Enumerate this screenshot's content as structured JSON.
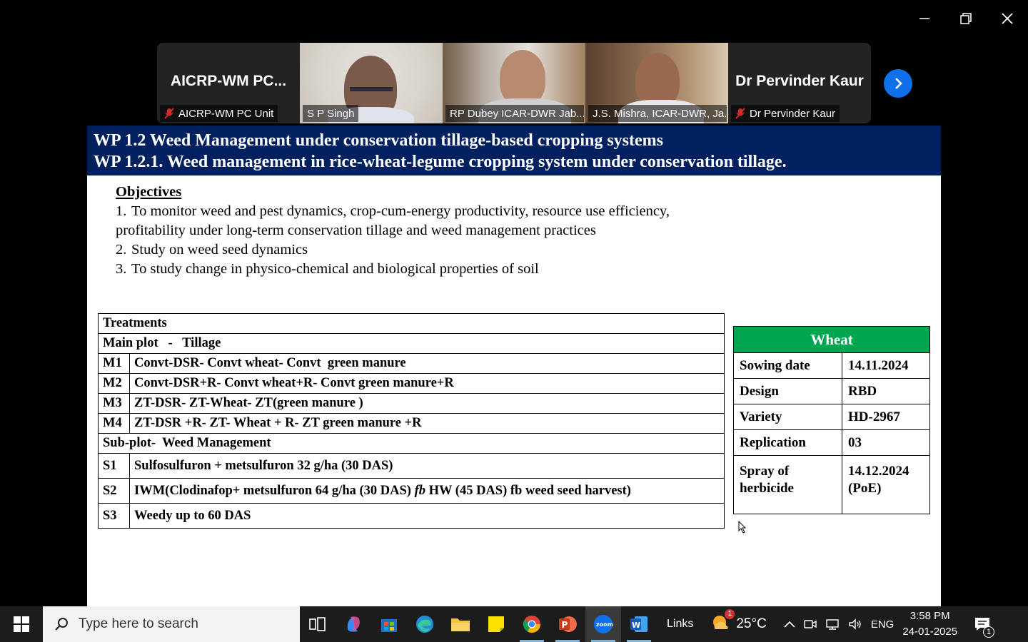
{
  "gallery": {
    "tiles": [
      {
        "big_name": "AICRP-WM PC...",
        "label": "AICRP-WM PC Unit",
        "muted": true
      },
      {
        "big_name": "",
        "label": "S P Singh",
        "muted": false
      },
      {
        "big_name": "",
        "label": "RP Dubey ICAR-DWR Jab...",
        "muted": false
      },
      {
        "big_name": "",
        "label": "J.S. Mishra, ICAR-DWR, Ja...",
        "muted": false
      },
      {
        "big_name": "Dr Pervinder Kaur",
        "label": "Dr Pervinder Kaur",
        "muted": true
      }
    ]
  },
  "slide": {
    "title_1": "WP 1.2 Weed Management under conservation tillage-based cropping systems",
    "title_2": "WP 1.2.1. Weed management in rice-wheat-legume cropping system under conservation tillage.",
    "objectives_heading": "Objectives",
    "objectives": [
      {
        "num": "1.",
        "line1": "To monitor weed and pest dynamics, crop-cum-energy productivity, resource use efficiency,",
        "line2": "profitability under long-term conservation tillage and weed management practices"
      },
      {
        "num": "2.",
        "line1": "Study on weed seed dynamics"
      },
      {
        "num": "3.",
        "line1": "To study change in physico-chemical and biological properties of soil"
      }
    ],
    "treatments": {
      "heading": "Treatments",
      "main_plot": "Main plot   -   Tillage",
      "main_rows": [
        {
          "code": "M1",
          "desc": "Convt-DSR- Convt wheat- Convt  green manure"
        },
        {
          "code": "M2",
          "desc": "Convt-DSR+R- Convt wheat+R- Convt green manure+R"
        },
        {
          "code": "M3",
          "desc": "ZT-DSR- ZT-Wheat- ZT(green manure )"
        },
        {
          "code": "M4",
          "desc": "ZT-DSR +R- ZT- Wheat + R- ZT green manure +R"
        }
      ],
      "sub_plot": "Sub-plot-  Weed Management",
      "sub_rows": [
        {
          "code": "S1",
          "desc": "Sulfosulfuron + metsulfuron 32 g/ha (30 DAS)"
        },
        {
          "code": "S2",
          "desc_a": "IWM(Clodinafop+ metsulfuron 64 g/ha (30 DAS) ",
          "desc_fb": "fb",
          "desc_b": " HW (45 DAS) fb weed seed harvest)"
        },
        {
          "code": "S3",
          "desc": "Weedy up to 60 DAS"
        }
      ]
    },
    "wheat": {
      "heading": "Wheat",
      "rows": [
        {
          "k": "Sowing date",
          "v": "14.11.2024"
        },
        {
          "k": "Design",
          "v": "RBD"
        },
        {
          "k": "Variety",
          "v": "HD-2967"
        },
        {
          "k": "Replication",
          "v": "03"
        }
      ],
      "spray_k1": "Spray of",
      "spray_k2": "herbicide",
      "spray_v1": "14.12.2024",
      "spray_v2": "(PoE)"
    }
  },
  "taskbar": {
    "search_placeholder": "Type here to search",
    "links": "Links",
    "weather_temp": "25°C",
    "weather_badge": "1",
    "language": "ENG",
    "time": "3:58 PM",
    "date": "24-01-2025",
    "notification_count": "1"
  },
  "colors": {
    "slide_header": "#002060",
    "wheat_header": "#00a650",
    "active_speaker": "#1fd15c",
    "zoom_blue": "#0e71eb",
    "muted_red": "#e02828"
  }
}
